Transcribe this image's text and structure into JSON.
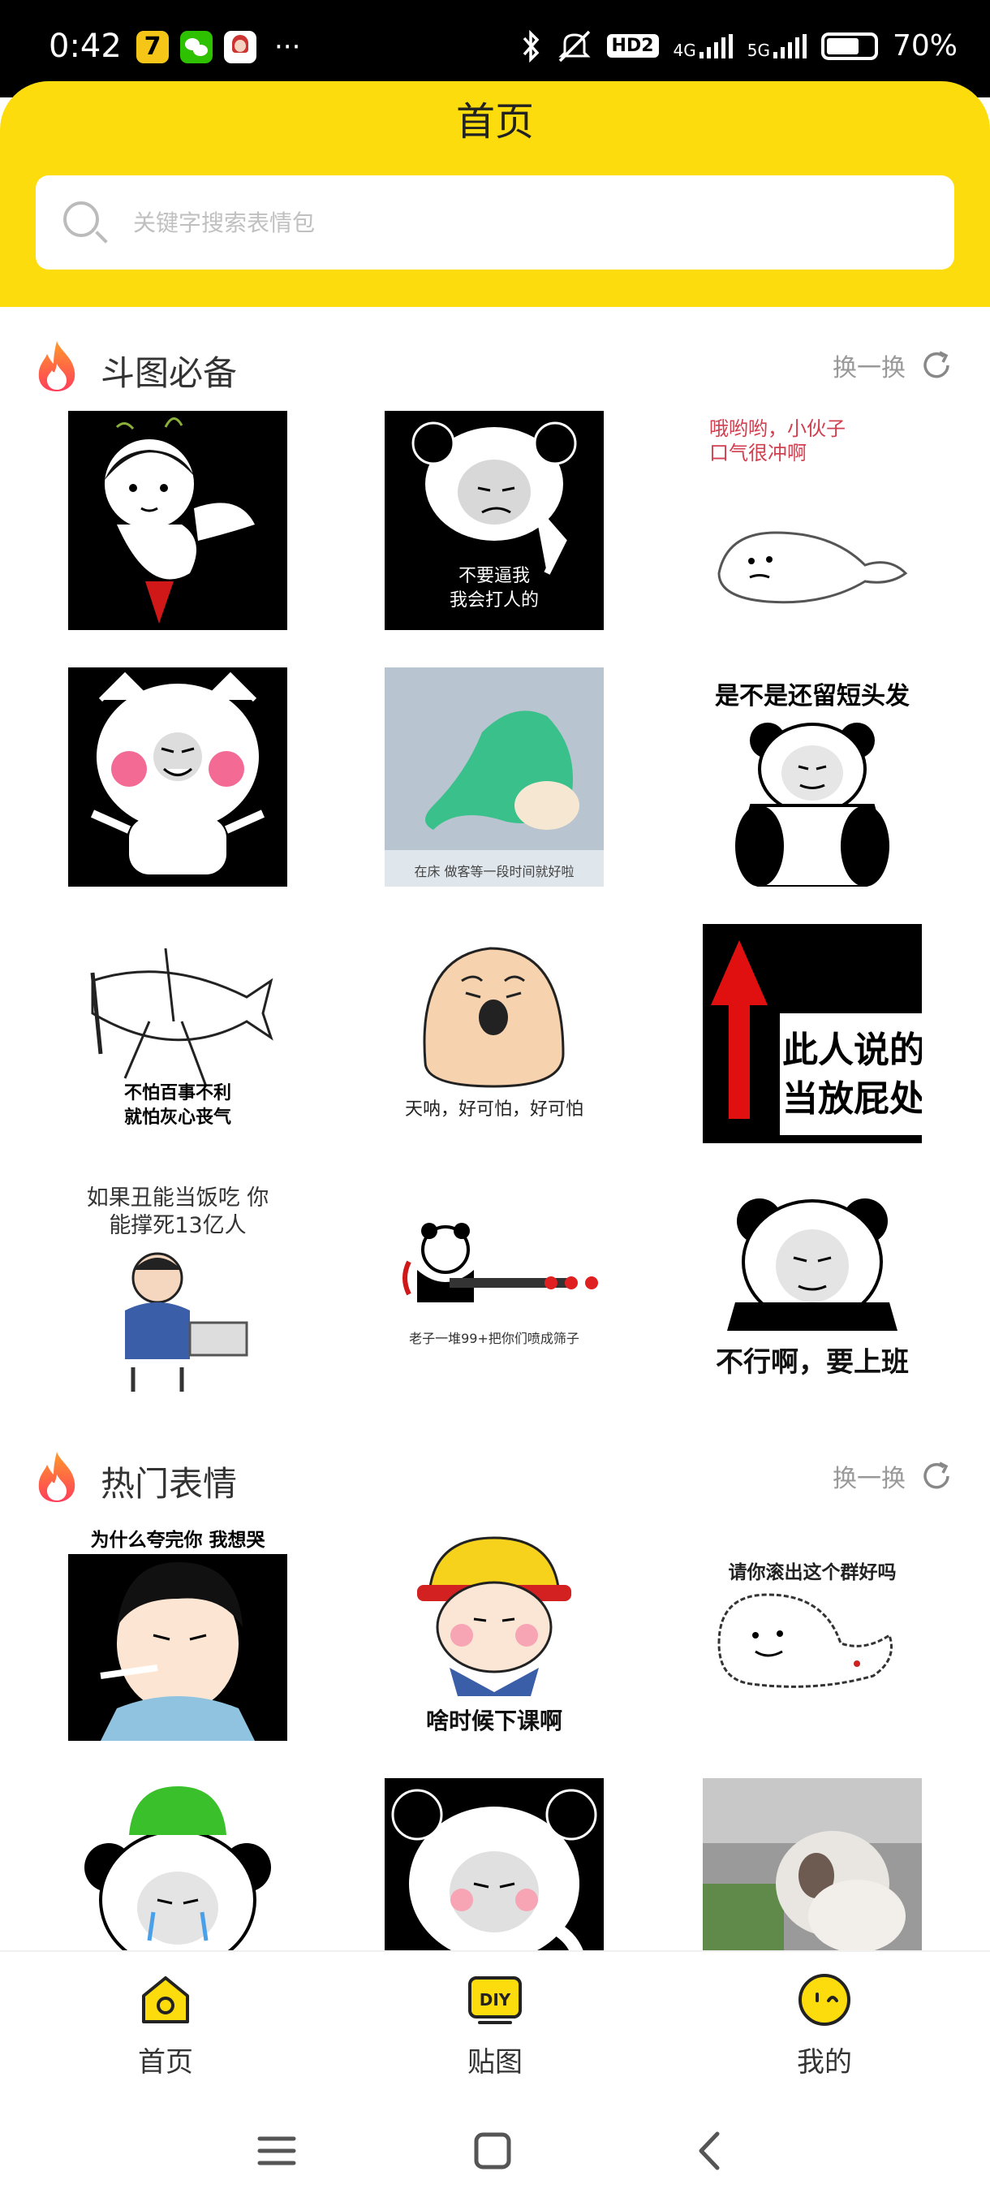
{
  "status_bar": {
    "time": "0:42",
    "hd_label": "HD2",
    "net_4g": "4G",
    "net_5g": "5G",
    "battery_percent": "70%",
    "battery_level": 0.7,
    "more_dots": "···"
  },
  "header": {
    "title": "首页",
    "search_placeholder": "关键字搜索表情包",
    "accent_color": "#FDDC0E"
  },
  "sections": [
    {
      "title": "斗图必备",
      "refresh_label": "换一换",
      "items": [
        {
          "caption": "",
          "icon": "meme-cupid-girl"
        },
        {
          "caption": "不要逼我 我会打人的",
          "icon": "meme-panda-face"
        },
        {
          "caption": "哦哟哟，小伙子 口气很冲啊",
          "icon": "meme-seal"
        },
        {
          "caption": "",
          "icon": "meme-cat-blush"
        },
        {
          "caption": "在床 做客等一段时间就好啦",
          "icon": "meme-anime-girl-lying"
        },
        {
          "caption": "是不是还留短头发",
          "icon": "meme-panda-standing"
        },
        {
          "caption": "不怕百事不利 就怕灰心丧气",
          "icon": "meme-fish-sketch"
        },
        {
          "caption": "天呐，好可怕，好可怕",
          "icon": "meme-potato-scared"
        },
        {
          "caption": "此人说的话 当放屁处理",
          "icon": "meme-red-arrow"
        },
        {
          "caption": "如果丑能当饭吃 你能撑死13亿人",
          "icon": "meme-man-laptop"
        },
        {
          "caption": "老子一堆99+把你们喷成筛子",
          "icon": "meme-panda-gun"
        },
        {
          "caption": "不行啊，要上班",
          "icon": "meme-panda-work"
        }
      ]
    },
    {
      "title": "热门表情",
      "refresh_label": "换一换",
      "items": [
        {
          "caption": "为什么夸完你 我想哭",
          "icon": "meme-man-smoking"
        },
        {
          "caption": "啥时候下课啊",
          "icon": "meme-yellow-helmet"
        },
        {
          "caption": "请你滚出这个群好吗",
          "icon": "meme-seal-sketch"
        },
        {
          "caption": "",
          "icon": "meme-panda-green-hat"
        },
        {
          "caption": "",
          "icon": "meme-panda-thinking"
        },
        {
          "caption": "",
          "icon": "meme-monkey-photo"
        }
      ]
    }
  ],
  "tab_bar": {
    "tabs": [
      {
        "label": "首页",
        "icon": "home-icon"
      },
      {
        "label": "贴图",
        "icon": "diy-icon"
      },
      {
        "label": "我的",
        "icon": "face-icon"
      }
    ],
    "diy_badge": "DIY"
  },
  "nav_bar": {
    "buttons": [
      "menu",
      "home",
      "back"
    ]
  }
}
